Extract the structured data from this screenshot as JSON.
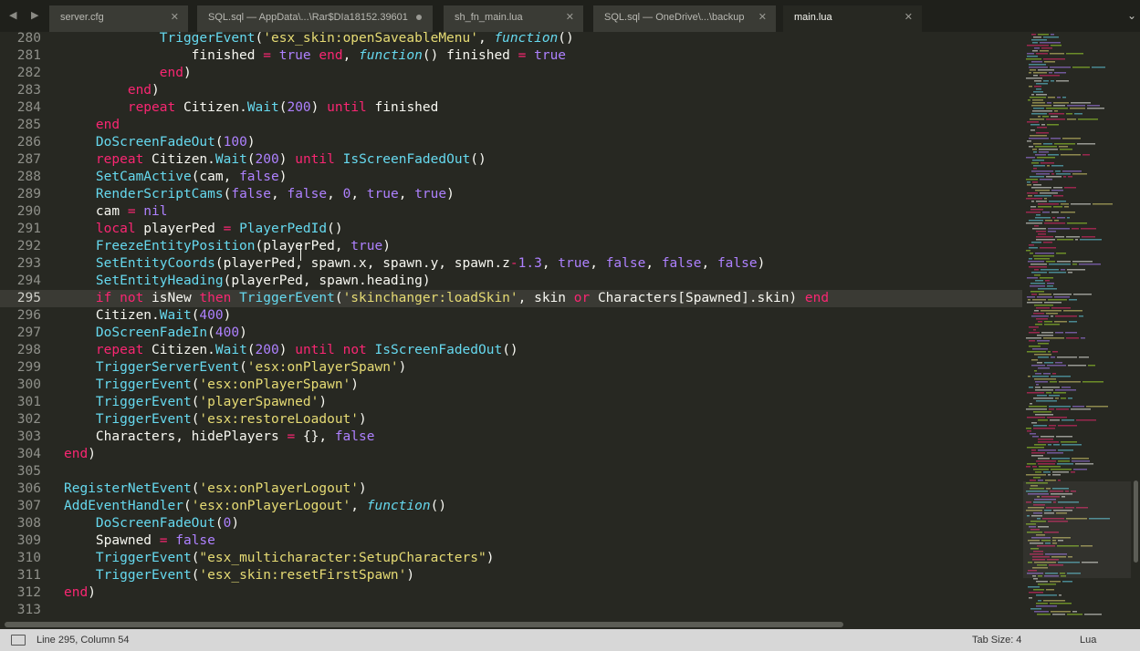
{
  "tabs": [
    {
      "label": "server.cfg",
      "state": "close"
    },
    {
      "label": "SQL.sql — AppData\\...\\Rar$DIa18152.39601",
      "state": "modified"
    },
    {
      "label": "sh_fn_main.lua",
      "state": "close"
    },
    {
      "label": "SQL.sql — OneDrive\\...\\backup",
      "state": "close"
    },
    {
      "label": "main.lua",
      "state": "active"
    }
  ],
  "icons": {
    "close": "✕",
    "nav": "◀ ▶",
    "menu": "⌄"
  },
  "code_lines": [
    {
      "n": "280",
      "t": [
        [
          "",
          "            "
        ],
        [
          "f",
          "TriggerEvent"
        ],
        [
          "",
          "("
        ],
        [
          "s",
          "'esx_skin:openSaveableMenu'"
        ],
        [
          "",
          ", "
        ],
        [
          "i",
          "function"
        ],
        [
          "",
          "()"
        ]
      ]
    },
    {
      "n": "281",
      "t": [
        [
          "",
          "                finished "
        ],
        [
          "k",
          "="
        ],
        [
          "",
          ""
        ],
        [
          "n",
          " true"
        ],
        [
          "k",
          " end"
        ],
        [
          "",
          ", "
        ],
        [
          "i",
          "function"
        ],
        [
          "",
          "() finished "
        ],
        [
          "k",
          "="
        ],
        [
          "n",
          " true"
        ]
      ]
    },
    {
      "n": "282",
      "t": [
        [
          "",
          "            "
        ],
        [
          "k",
          "end"
        ],
        [
          "",
          ")"
        ]
      ]
    },
    {
      "n": "283",
      "t": [
        [
          "",
          "        "
        ],
        [
          "k",
          "end"
        ],
        [
          "",
          ")"
        ]
      ]
    },
    {
      "n": "284",
      "t": [
        [
          "",
          "        "
        ],
        [
          "k",
          "repeat"
        ],
        [
          "",
          " Citizen."
        ],
        [
          "f",
          "Wait"
        ],
        [
          "",
          "("
        ],
        [
          "n",
          "200"
        ],
        [
          "",
          ") "
        ],
        [
          "k",
          "until"
        ],
        [
          "",
          " finished"
        ]
      ]
    },
    {
      "n": "285",
      "t": [
        [
          "",
          "    "
        ],
        [
          "k",
          "end"
        ]
      ]
    },
    {
      "n": "286",
      "t": [
        [
          "",
          "    "
        ],
        [
          "f",
          "DoScreenFadeOut"
        ],
        [
          "",
          "("
        ],
        [
          "n",
          "100"
        ],
        [
          "",
          ")"
        ]
      ]
    },
    {
      "n": "287",
      "t": [
        [
          "",
          "    "
        ],
        [
          "k",
          "repeat"
        ],
        [
          "",
          " Citizen."
        ],
        [
          "f",
          "Wait"
        ],
        [
          "",
          "("
        ],
        [
          "n",
          "200"
        ],
        [
          "",
          ") "
        ],
        [
          "k",
          "until"
        ],
        [
          "",
          ""
        ],
        [
          "f",
          " IsScreenFadedOut"
        ],
        [
          "",
          "()"
        ]
      ]
    },
    {
      "n": "288",
      "t": [
        [
          "",
          "    "
        ],
        [
          "f",
          "SetCamActive"
        ],
        [
          "",
          "(cam, "
        ],
        [
          "n",
          "false"
        ],
        [
          "",
          ")"
        ]
      ]
    },
    {
      "n": "289",
      "t": [
        [
          "",
          "    "
        ],
        [
          "f",
          "RenderScriptCams"
        ],
        [
          "",
          "("
        ],
        [
          "n",
          "false"
        ],
        [
          "",
          ", "
        ],
        [
          "n",
          "false"
        ],
        [
          "",
          ", "
        ],
        [
          "n",
          "0"
        ],
        [
          "",
          ", "
        ],
        [
          "n",
          "true"
        ],
        [
          "",
          ", "
        ],
        [
          "n",
          "true"
        ],
        [
          "",
          ")"
        ]
      ]
    },
    {
      "n": "290",
      "t": [
        [
          "",
          "    cam "
        ],
        [
          "k",
          "="
        ],
        [
          "n",
          " nil"
        ]
      ]
    },
    {
      "n": "291",
      "t": [
        [
          "",
          "    "
        ],
        [
          "k",
          "local"
        ],
        [
          "",
          " playerPed "
        ],
        [
          "k",
          "="
        ],
        [
          "f",
          " PlayerPedId"
        ],
        [
          "",
          "()"
        ]
      ]
    },
    {
      "n": "292",
      "t": [
        [
          "",
          "    "
        ],
        [
          "f",
          "FreezeEntityPosition"
        ],
        [
          "",
          "(playerPed, "
        ],
        [
          "n",
          "true"
        ],
        [
          "",
          ")"
        ]
      ]
    },
    {
      "n": "293",
      "t": [
        [
          "",
          "    "
        ],
        [
          "f",
          "SetEntityCoords"
        ],
        [
          "",
          "(playerPed, spawn.x, spawn.y, spawn.z"
        ],
        [
          "k",
          "-"
        ],
        [
          "n",
          "1.3"
        ],
        [
          "",
          ", "
        ],
        [
          "n",
          "true"
        ],
        [
          "",
          ", "
        ],
        [
          "n",
          "false"
        ],
        [
          "",
          ", "
        ],
        [
          "n",
          "false"
        ],
        [
          "",
          ", "
        ],
        [
          "n",
          "false"
        ],
        [
          "",
          ")"
        ]
      ]
    },
    {
      "n": "294",
      "t": [
        [
          "",
          "    "
        ],
        [
          "f",
          "SetEntityHeading"
        ],
        [
          "",
          "(playerPed, spawn.heading)"
        ]
      ]
    },
    {
      "n": "295",
      "t": [
        [
          "",
          "    "
        ],
        [
          "k",
          "if not"
        ],
        [
          "",
          " isNew "
        ],
        [
          "k",
          "then"
        ],
        [
          "f",
          " TriggerEvent"
        ],
        [
          "",
          "("
        ],
        [
          "s",
          "'skinchanger:loadSkin'"
        ],
        [
          "",
          ", skin "
        ],
        [
          "k",
          "or"
        ],
        [
          "",
          " Characters[Spawned].skin) "
        ],
        [
          "k",
          "end"
        ]
      ]
    },
    {
      "n": "296",
      "t": [
        [
          "",
          "    Citizen."
        ],
        [
          "f",
          "Wait"
        ],
        [
          "",
          "("
        ],
        [
          "n",
          "400"
        ],
        [
          "",
          ")"
        ]
      ]
    },
    {
      "n": "297",
      "t": [
        [
          "",
          "    "
        ],
        [
          "f",
          "DoScreenFadeIn"
        ],
        [
          "",
          "("
        ],
        [
          "n",
          "400"
        ],
        [
          "",
          ")"
        ]
      ]
    },
    {
      "n": "298",
      "t": [
        [
          "",
          "    "
        ],
        [
          "k",
          "repeat"
        ],
        [
          "",
          " Citizen."
        ],
        [
          "f",
          "Wait"
        ],
        [
          "",
          "("
        ],
        [
          "n",
          "200"
        ],
        [
          "",
          ") "
        ],
        [
          "k",
          "until not"
        ],
        [
          "f",
          " IsScreenFadedOut"
        ],
        [
          "",
          "()"
        ]
      ]
    },
    {
      "n": "299",
      "t": [
        [
          "",
          "    "
        ],
        [
          "f",
          "TriggerServerEvent"
        ],
        [
          "",
          "("
        ],
        [
          "s",
          "'esx:onPlayerSpawn'"
        ],
        [
          "",
          ")"
        ]
      ]
    },
    {
      "n": "300",
      "t": [
        [
          "",
          "    "
        ],
        [
          "f",
          "TriggerEvent"
        ],
        [
          "",
          "("
        ],
        [
          "s",
          "'esx:onPlayerSpawn'"
        ],
        [
          "",
          ")"
        ]
      ]
    },
    {
      "n": "301",
      "t": [
        [
          "",
          "    "
        ],
        [
          "f",
          "TriggerEvent"
        ],
        [
          "",
          "("
        ],
        [
          "s",
          "'playerSpawned'"
        ],
        [
          "",
          ")"
        ]
      ]
    },
    {
      "n": "302",
      "t": [
        [
          "",
          "    "
        ],
        [
          "f",
          "TriggerEvent"
        ],
        [
          "",
          "("
        ],
        [
          "s",
          "'esx:restoreLoadout'"
        ],
        [
          "",
          ")"
        ]
      ]
    },
    {
      "n": "303",
      "t": [
        [
          "",
          "    Characters, hidePlayers "
        ],
        [
          "k",
          "="
        ],
        [
          "",
          " {}, "
        ],
        [
          "n",
          "false"
        ]
      ]
    },
    {
      "n": "304",
      "t": [
        [
          "",
          ""
        ],
        [
          "k",
          "end"
        ],
        [
          "",
          ")"
        ]
      ]
    },
    {
      "n": "305",
      "t": [
        [
          "",
          ""
        ]
      ]
    },
    {
      "n": "306",
      "t": [
        [
          "",
          ""
        ],
        [
          "f",
          "RegisterNetEvent"
        ],
        [
          "",
          "("
        ],
        [
          "s",
          "'esx:onPlayerLogout'"
        ],
        [
          "",
          ")"
        ]
      ]
    },
    {
      "n": "307",
      "t": [
        [
          "",
          ""
        ],
        [
          "f",
          "AddEventHandler"
        ],
        [
          "",
          "("
        ],
        [
          "s",
          "'esx:onPlayerLogout'"
        ],
        [
          "",
          ", "
        ],
        [
          "i",
          "function"
        ],
        [
          "",
          "()"
        ]
      ]
    },
    {
      "n": "308",
      "t": [
        [
          "",
          "    "
        ],
        [
          "f",
          "DoScreenFadeOut"
        ],
        [
          "",
          "("
        ],
        [
          "n",
          "0"
        ],
        [
          "",
          ")"
        ]
      ]
    },
    {
      "n": "309",
      "t": [
        [
          "",
          "    Spawned "
        ],
        [
          "k",
          "="
        ],
        [
          "n",
          " false"
        ]
      ]
    },
    {
      "n": "310",
      "t": [
        [
          "",
          "    "
        ],
        [
          "f",
          "TriggerEvent"
        ],
        [
          "",
          "("
        ],
        [
          "s",
          "\"esx_multicharacter:SetupCharacters\""
        ],
        [
          "",
          ")"
        ]
      ]
    },
    {
      "n": "311",
      "t": [
        [
          "",
          "    "
        ],
        [
          "f",
          "TriggerEvent"
        ],
        [
          "",
          "("
        ],
        [
          "s",
          "'esx_skin:resetFirstSpawn'"
        ],
        [
          "",
          ")"
        ]
      ]
    },
    {
      "n": "312",
      "t": [
        [
          "",
          ""
        ],
        [
          "k",
          "end"
        ],
        [
          "",
          ")"
        ]
      ]
    },
    {
      "n": "313",
      "t": [
        [
          "",
          ""
        ]
      ]
    }
  ],
  "current_line": "295",
  "status": {
    "position": "Line 295, Column 54",
    "tab_size": "Tab Size: 4",
    "syntax": "Lua"
  }
}
